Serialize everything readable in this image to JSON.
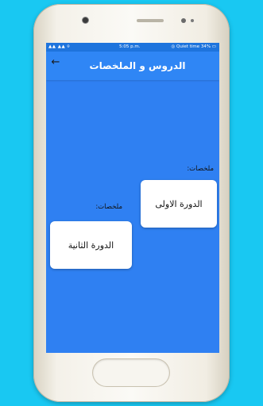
{
  "status_bar": {
    "left": "▲▲ ▲▲ ⌾",
    "time": "5:05 p.m.",
    "right": "◎ Quiet time 34% ▭"
  },
  "app_bar": {
    "back_icon": "←",
    "title": "الدروس و الملخصات"
  },
  "items": [
    {
      "label": "ملخصات:",
      "card_text": "الدورة الاولى"
    },
    {
      "label": "ملخصات:",
      "card_text": "الدورة الثانية"
    }
  ],
  "colors": {
    "background": "#19c8f2",
    "screen": "#2f80f2",
    "app_bar": "#2f86f5",
    "status_bar": "#1e74dd"
  }
}
